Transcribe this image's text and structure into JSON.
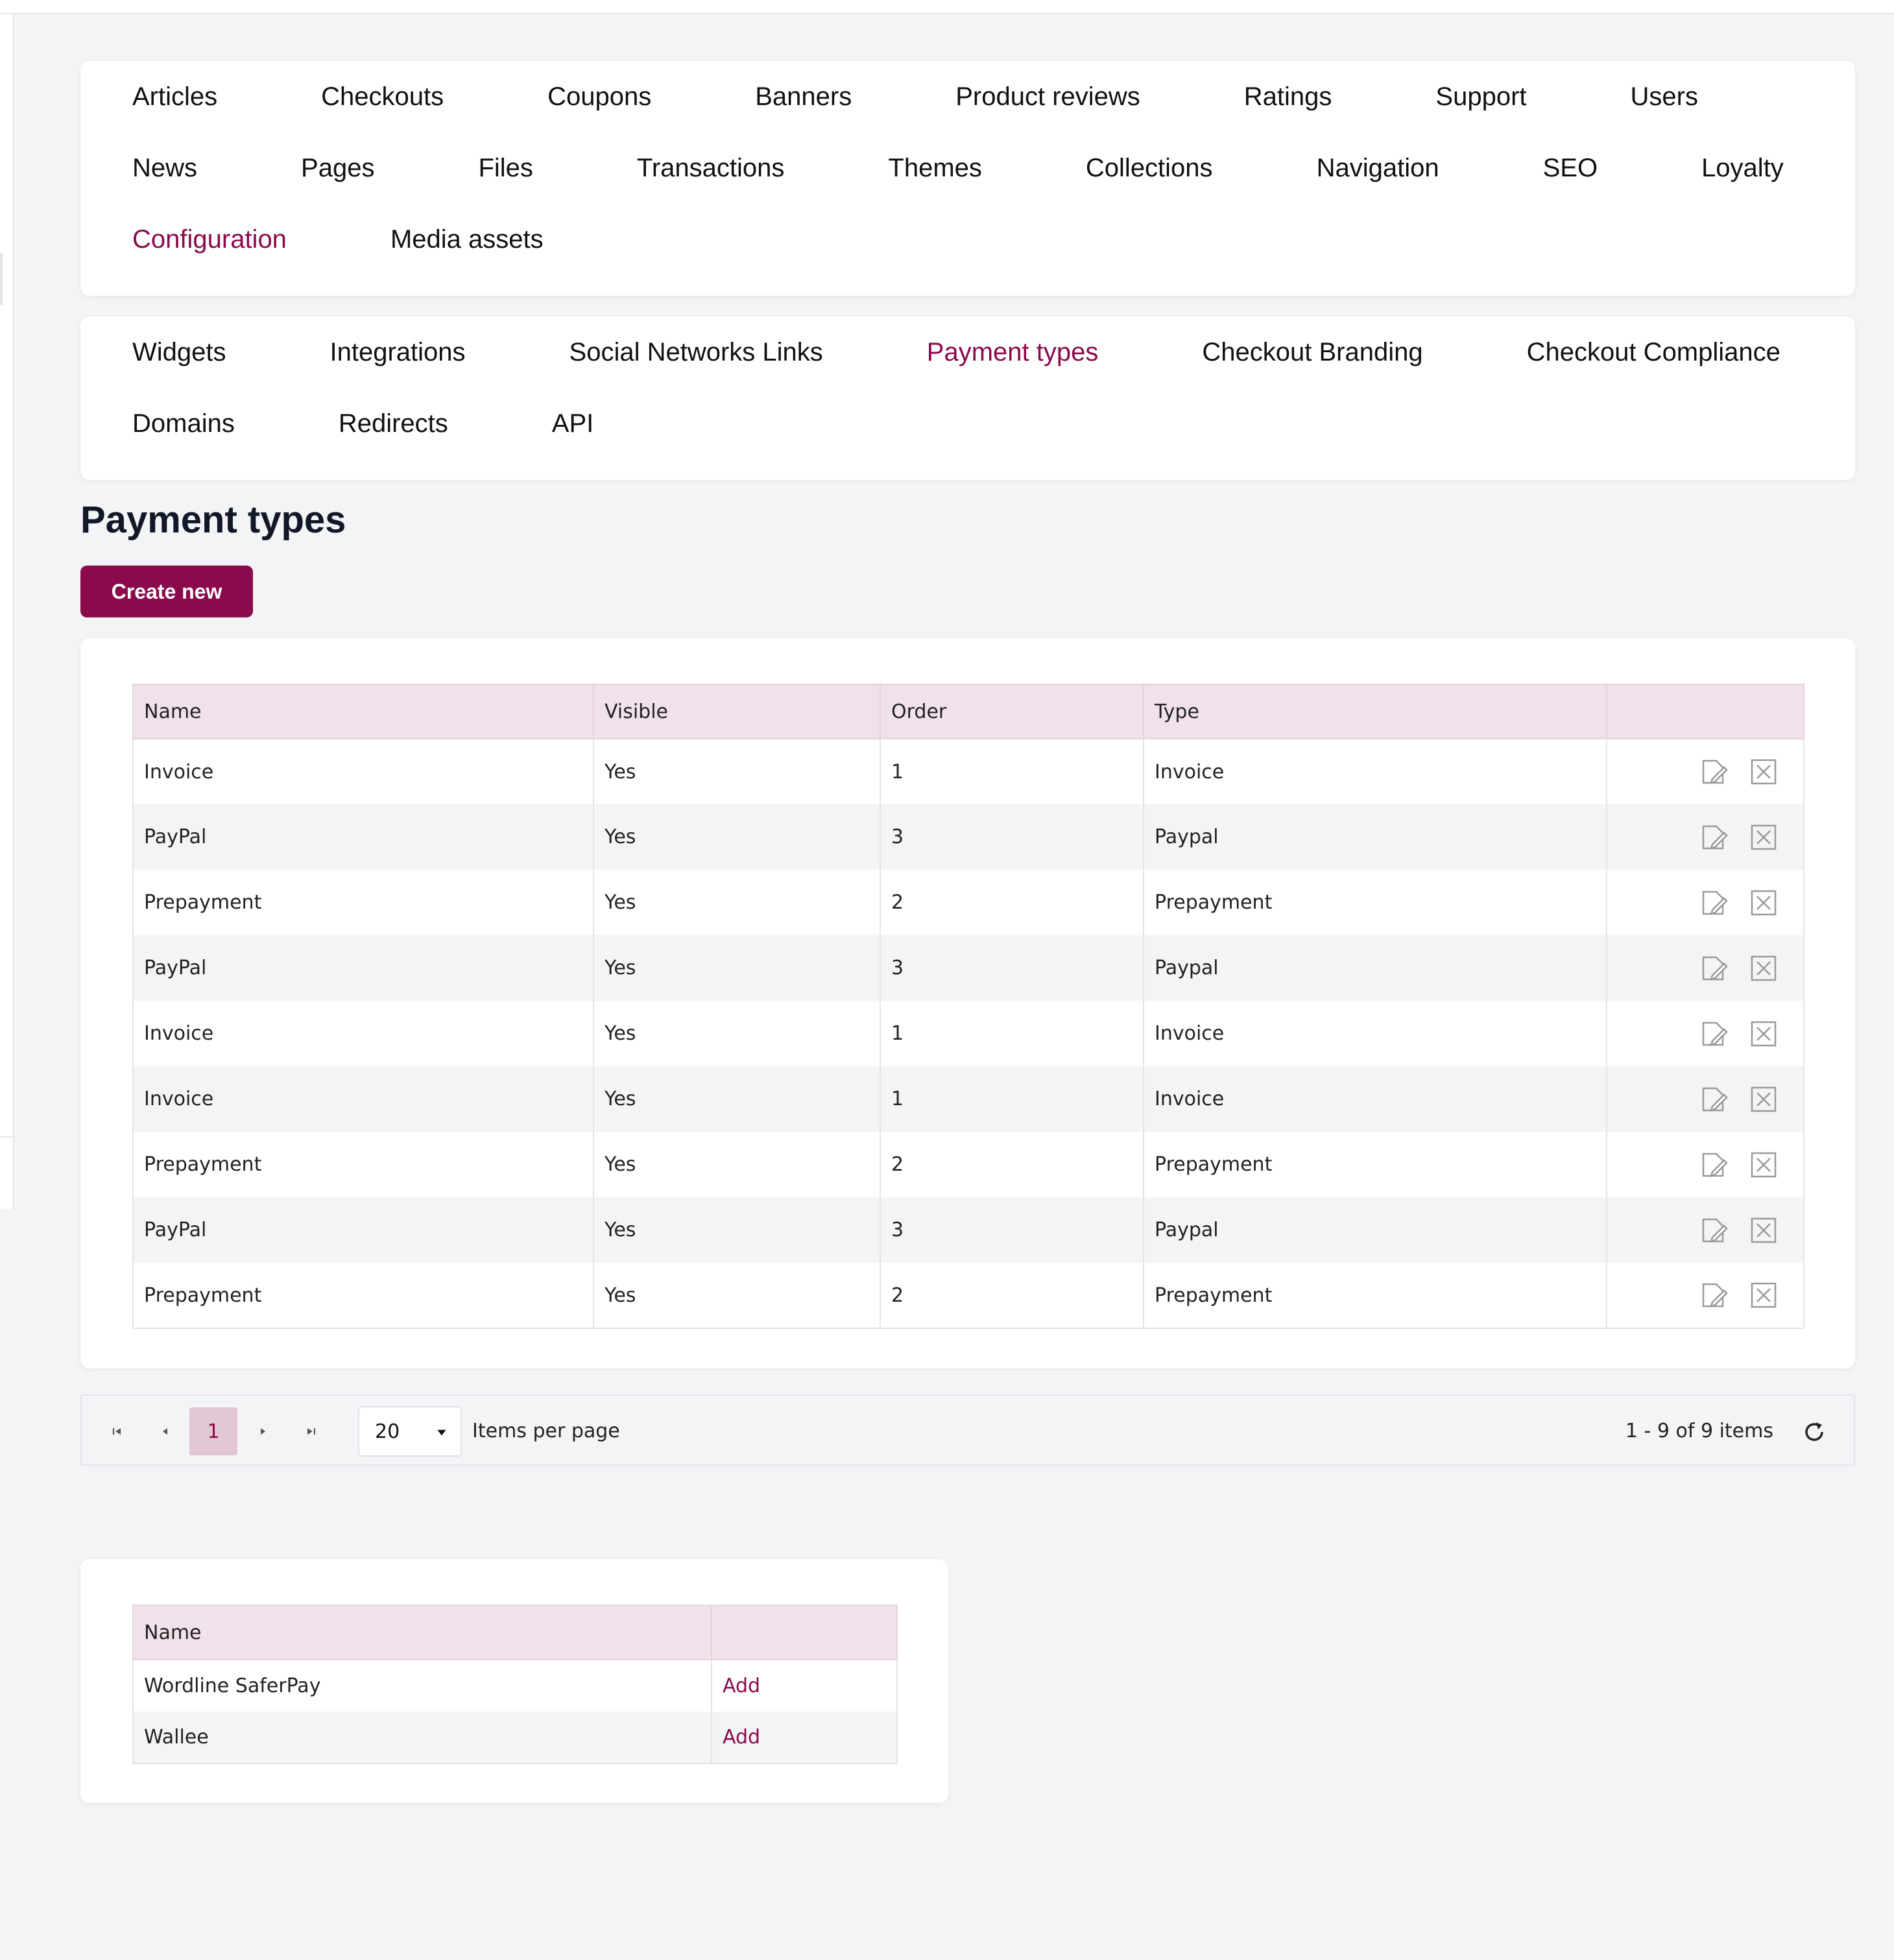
{
  "colors": {
    "accent": "#8a0a4b",
    "header_bg": "#f1e1ea",
    "page_bg": "#f3f4f6"
  },
  "main_nav": [
    {
      "label": "Articles",
      "active": false
    },
    {
      "label": "Checkouts",
      "active": false
    },
    {
      "label": "Coupons",
      "active": false
    },
    {
      "label": "Banners",
      "active": false
    },
    {
      "label": "Product reviews",
      "active": false
    },
    {
      "label": "Ratings",
      "active": false
    },
    {
      "label": "Support",
      "active": false
    },
    {
      "label": "Users",
      "active": false
    },
    {
      "label": "News",
      "active": false
    },
    {
      "label": "Pages",
      "active": false
    },
    {
      "label": "Files",
      "active": false
    },
    {
      "label": "Transactions",
      "active": false
    },
    {
      "label": "Themes",
      "active": false
    },
    {
      "label": "Collections",
      "active": false
    },
    {
      "label": "Navigation",
      "active": false
    },
    {
      "label": "SEO",
      "active": false
    },
    {
      "label": "Loyalty",
      "active": false
    },
    {
      "label": "Configuration",
      "active": true
    },
    {
      "label": "Media assets",
      "active": false
    }
  ],
  "sub_nav": [
    {
      "label": "Widgets",
      "active": false
    },
    {
      "label": "Integrations",
      "active": false
    },
    {
      "label": "Social Networks Links",
      "active": false
    },
    {
      "label": "Payment types",
      "active": true
    },
    {
      "label": "Checkout Branding",
      "active": false
    },
    {
      "label": "Checkout Compliance",
      "active": false
    },
    {
      "label": "Domains",
      "active": false
    },
    {
      "label": "Redirects",
      "active": false
    },
    {
      "label": "API",
      "active": false
    }
  ],
  "page": {
    "title": "Payment types",
    "create_label": "Create new"
  },
  "payment_table": {
    "columns": [
      "Name",
      "Visible",
      "Order",
      "Type",
      ""
    ],
    "rows": [
      {
        "name": "Invoice",
        "visible": "Yes",
        "order": "1",
        "type": "Invoice"
      },
      {
        "name": "PayPal",
        "visible": "Yes",
        "order": "3",
        "type": "Paypal"
      },
      {
        "name": "Prepayment",
        "visible": "Yes",
        "order": "2",
        "type": "Prepayment"
      },
      {
        "name": "PayPal",
        "visible": "Yes",
        "order": "3",
        "type": "Paypal"
      },
      {
        "name": "Invoice",
        "visible": "Yes",
        "order": "1",
        "type": "Invoice"
      },
      {
        "name": "Invoice",
        "visible": "Yes",
        "order": "1",
        "type": "Invoice"
      },
      {
        "name": "Prepayment",
        "visible": "Yes",
        "order": "2",
        "type": "Prepayment"
      },
      {
        "name": "PayPal",
        "visible": "Yes",
        "order": "3",
        "type": "Paypal"
      },
      {
        "name": "Prepayment",
        "visible": "Yes",
        "order": "2",
        "type": "Prepayment"
      }
    ],
    "row_icons": [
      "edit-icon",
      "delete-icon"
    ]
  },
  "pager": {
    "current_page": "1",
    "page_size": "20",
    "page_size_label": "Items per page",
    "info": "1 - 9 of 9 items",
    "icons": [
      "first-page-icon",
      "prev-page-icon",
      "next-page-icon",
      "last-page-icon",
      "refresh-icon"
    ]
  },
  "providers_table": {
    "columns": [
      "Name",
      ""
    ],
    "rows": [
      {
        "name": "Wordline SaferPay",
        "action": "Add"
      },
      {
        "name": "Wallee",
        "action": "Add"
      }
    ]
  }
}
